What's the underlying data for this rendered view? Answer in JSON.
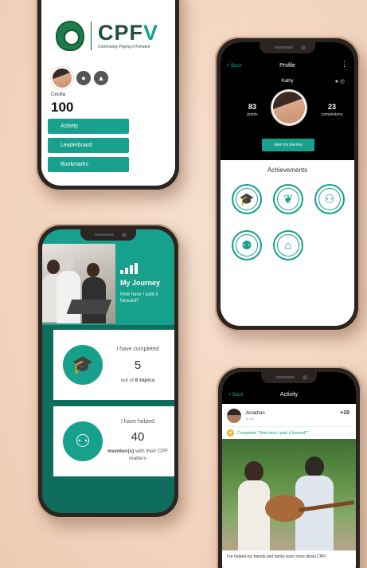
{
  "colors": {
    "accent": "#17a08c",
    "dark_green": "#0f6d5e",
    "brand_navy": "#1f4f3c"
  },
  "home": {
    "brand_name": "CPF",
    "brand_v": "V",
    "tagline": "Community Paying it Forward",
    "user_name": "Cecilia",
    "points": "100",
    "menu": [
      "Activity",
      "Leaderboard",
      "Bookmarks"
    ],
    "icons": [
      "chat-icon",
      "bell-icon"
    ]
  },
  "profile": {
    "back": "< Back",
    "title": "Profile",
    "name": "Kathy",
    "points_value": "83",
    "points_label": "points",
    "completions_value": "23",
    "completions_label": "completions",
    "journey_button": "view my journey",
    "achievements_title": "Achievements",
    "badges": [
      "graduation-cap-icon",
      "sprout-icon",
      "family-icon",
      "group-icon",
      "home-icon"
    ]
  },
  "journey": {
    "title": "My Journey",
    "subtitle": "How have I paid it forward?",
    "completed_label": "I have completed",
    "completed_value": "5",
    "completed_prefix": "out of ",
    "completed_total": "6 topics",
    "helped_label": "I have helped",
    "helped_value": "40",
    "helped_strong": "member(s)",
    "helped_suffix": " with their CPF matters"
  },
  "activity": {
    "back": "< Back",
    "title": "Activity",
    "poster": "Jonathan",
    "time": "1h 5m",
    "points": "+10",
    "completed_text": "Completed \"How have I paid it forward?\"",
    "caption": "I've helped my friends and family learn more about CPF!"
  }
}
